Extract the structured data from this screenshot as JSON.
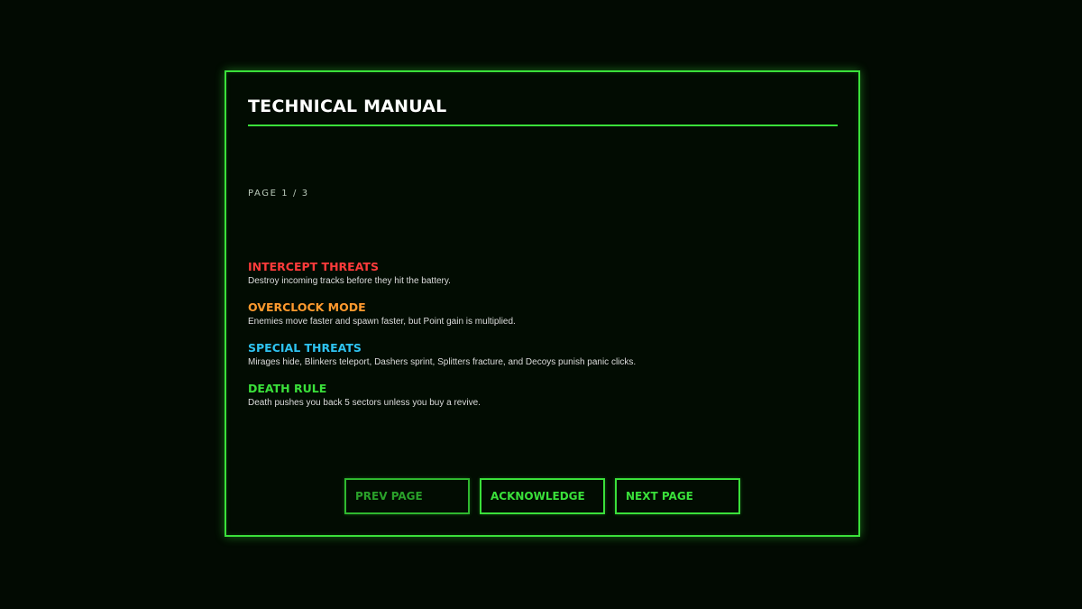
{
  "manual": {
    "title": "TECHNICAL MANUAL",
    "page_indicator": "PAGE 1 / 3",
    "rules": [
      {
        "title": "INTERCEPT THREATS",
        "description": "Destroy incoming tracks before they hit the battery.",
        "color": "#ff3b3b"
      },
      {
        "title": "OVERCLOCK MODE",
        "description": "Enemies move faster and spawn faster, but Point gain is multiplied.",
        "color": "#ff9a2e"
      },
      {
        "title": "SPECIAL THREATS",
        "description": "Mirages hide, Blinkers teleport, Dashers sprint, Splitters fracture, and Decoys punish panic clicks.",
        "color": "#2ec3f0"
      },
      {
        "title": "DEATH RULE",
        "description": "Death pushes you back 5 sectors unless you buy a revive.",
        "color": "#3ae03a"
      }
    ],
    "buttons": {
      "prev_label": "PREV PAGE",
      "acknowledge_label": "ACKNOWLEDGE",
      "next_label": "NEXT PAGE"
    }
  },
  "theme": {
    "accent": "#3ae03a",
    "background": "#020a02"
  }
}
